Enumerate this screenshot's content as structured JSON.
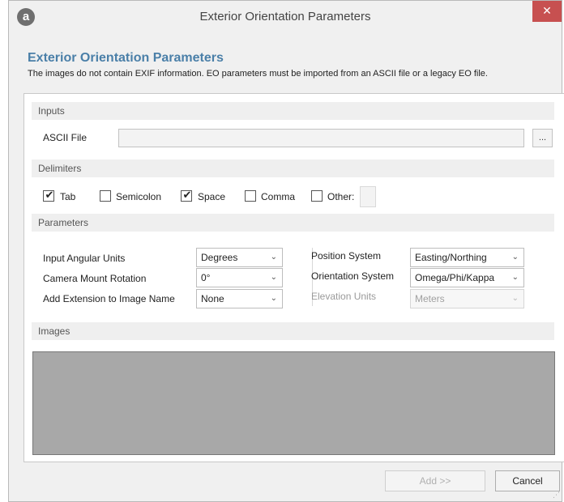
{
  "window": {
    "title": "Exterior Orientation Parameters",
    "app_icon_glyph": "a",
    "close_glyph": "✕",
    "accent_color": "#4a7fa8",
    "close_color": "#c75050"
  },
  "header": {
    "title": "Exterior Orientation Parameters",
    "description": "The images do not contain EXIF information. EO parameters must be imported from an ASCII file or a legacy EO file."
  },
  "inputs": {
    "section_label": "Inputs",
    "ascii_label": "ASCII File",
    "ascii_value": "",
    "browse_label": "..."
  },
  "delimiters": {
    "section_label": "Delimiters",
    "tab": {
      "label": "Tab",
      "checked": true
    },
    "semicolon": {
      "label": "Semicolon",
      "checked": false
    },
    "space": {
      "label": "Space",
      "checked": true
    },
    "comma": {
      "label": "Comma",
      "checked": false
    },
    "other": {
      "label": "Other:",
      "checked": false,
      "value": ""
    },
    "check_glyph": "✔"
  },
  "parameters": {
    "section_label": "Parameters",
    "input_angular_units": {
      "label": "Input Angular Units",
      "value": "Degrees"
    },
    "camera_mount_rotation": {
      "label": "Camera Mount Rotation",
      "value": "0°"
    },
    "add_extension": {
      "label": "Add Extension to Image Name",
      "value": "None"
    },
    "position_system": {
      "label": "Position System",
      "value": "Easting/Northing"
    },
    "orientation_system": {
      "label": "Orientation System",
      "value": "Omega/Phi/Kappa"
    },
    "elevation_units": {
      "label": "Elevation Units",
      "value": "Meters",
      "enabled": false
    },
    "chevron_glyph": "⌄"
  },
  "images": {
    "section_label": "Images"
  },
  "footer": {
    "add_label": "Add >>",
    "cancel_label": "Cancel"
  }
}
